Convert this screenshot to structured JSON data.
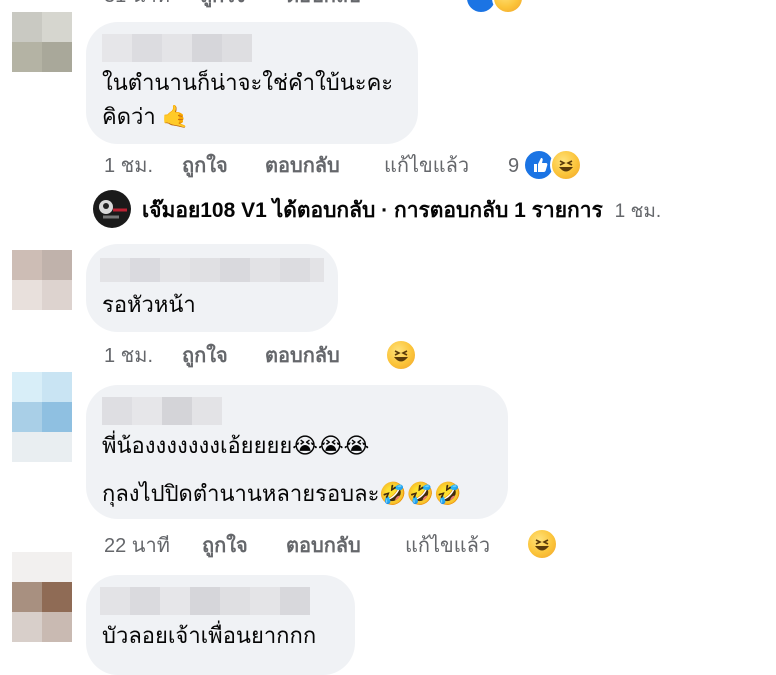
{
  "comments": [
    {
      "text_lines": [
        "ในตำนานก็น่าจะใช่คำใบ้นะคะ",
        "คิดว่า 🤙"
      ],
      "actions": {
        "time": "1 ชม.",
        "like": "ถูกใจ",
        "reply": "ตอบกลับ",
        "edited": "แก้ไขแล้ว",
        "reaction_count": "9"
      },
      "reactions": [
        "like-icon",
        "haha-icon"
      ]
    },
    {
      "text_lines": [
        "รอหัวหน้า"
      ],
      "actions": {
        "time": "1 ชม.",
        "like": "ถูกใจ",
        "reply": "ตอบกลับ"
      },
      "reactions": [
        "haha-icon"
      ]
    },
    {
      "text_lines": [
        "พี่น้องงงงงงงเอ้ยยยย😭😭😭",
        "กุลงไปปิดตำนานหลายรอบละ🤣🤣🤣"
      ],
      "actions": {
        "time": "22 นาที",
        "like": "ถูกใจ",
        "reply": "ตอบกลับ",
        "edited": "แก้ไขแล้ว"
      },
      "reactions": [
        "haha-icon"
      ]
    },
    {
      "text_lines": [
        "บัวลอยเจ้าเพื่อนยากกก"
      ]
    }
  ],
  "reply_thread": {
    "text": "เจ๊มอย108 V1 ได้ตอบกลับ · การตอบกลับ 1 รายการ",
    "time": "1 ชม."
  },
  "colors": {
    "bubble": "#f0f2f5",
    "secondary_text": "#65676b",
    "like_blue": "#1b74e4",
    "haha_yellow": "#fbc43a"
  }
}
